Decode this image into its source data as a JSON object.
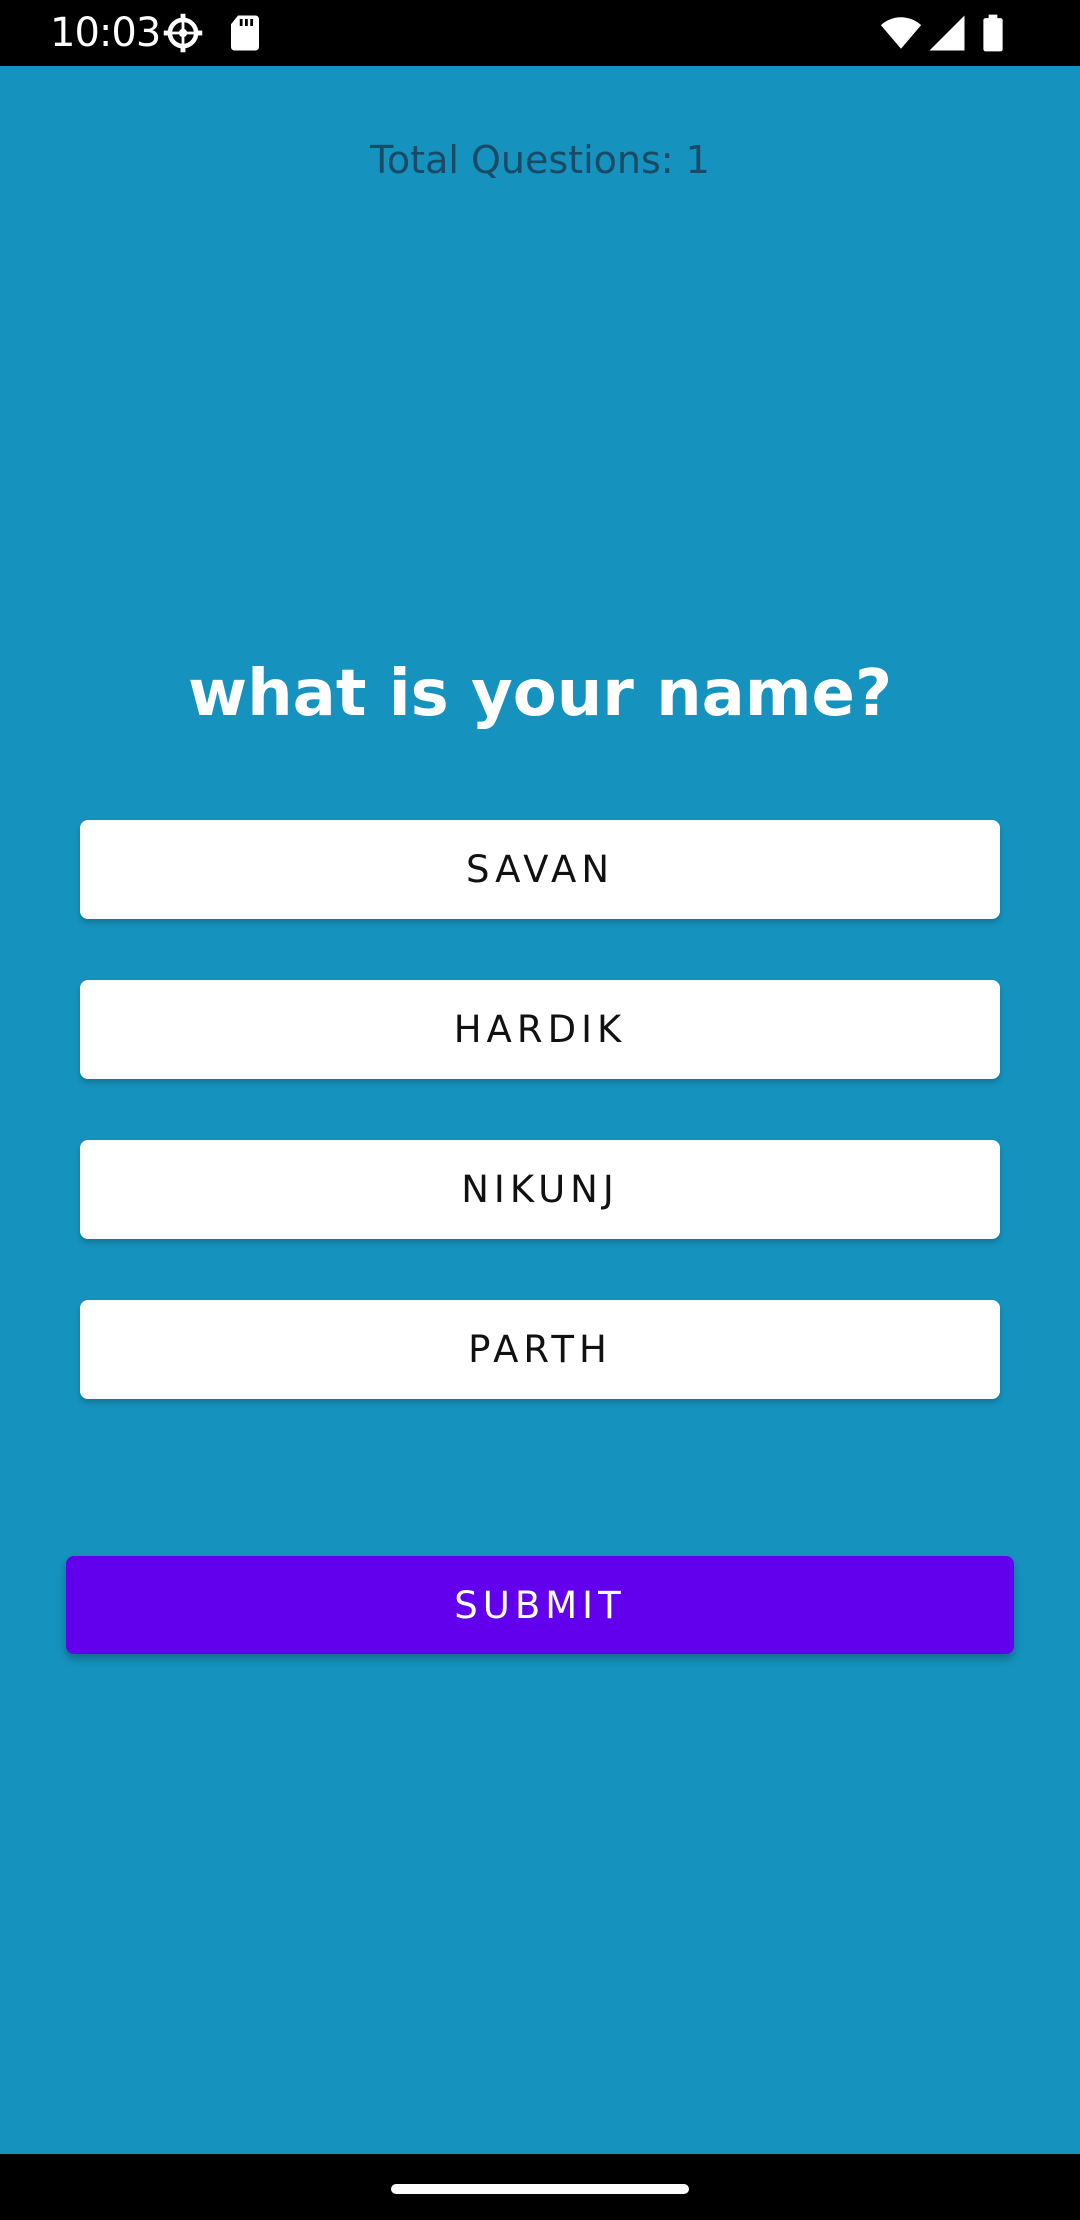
{
  "status_bar": {
    "time": "10:03",
    "icons": [
      "settings-gear-icon",
      "sd-card-icon",
      "wifi-icon",
      "cell-signal-icon",
      "battery-icon"
    ]
  },
  "quiz": {
    "total_questions_label": "Total Questions: 1",
    "question": "what is your name?",
    "options": [
      "SAVAN",
      "HARDIK",
      "NIKUNJ",
      "PARTH"
    ],
    "submit_label": "SUBMIT"
  },
  "colors": {
    "background": "#1592BD",
    "submit_button": "#6200EE",
    "option_button": "#FFFFFF",
    "system_bars": "#000000"
  }
}
